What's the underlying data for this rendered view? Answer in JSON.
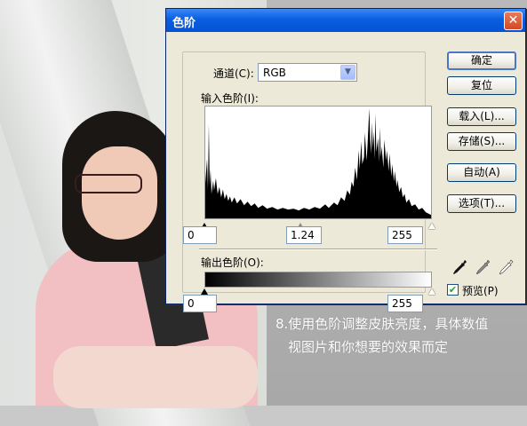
{
  "dialog": {
    "title": "色阶",
    "close_label": "✕",
    "channel": {
      "label": "通道(C):",
      "value": "RGB"
    },
    "input_levels": {
      "label": "输入色阶(I):",
      "black": "0",
      "gamma": "1.24",
      "white": "255"
    },
    "output_levels": {
      "label": "输出色阶(O):",
      "black": "0",
      "white": "255"
    },
    "buttons": {
      "ok": "确定",
      "reset": "复位",
      "load": "载入(L)...",
      "save": "存储(S)...",
      "auto": "自动(A)",
      "options": "选项(T)..."
    },
    "eyedroppers": [
      "black-point-eyedropper-icon",
      "gray-point-eyedropper-icon",
      "white-point-eyedropper-icon"
    ],
    "preview": {
      "label": "预览(P)",
      "checked": true
    }
  },
  "caption": {
    "line1": "8.使用色阶调整皮肤亮度，具体数值",
    "line2": "视图片和你想要的效果而定"
  },
  "colors": {
    "title_bar": "#0453d4",
    "dialog_bg": "#ece9d8",
    "close_button": "#d24a24",
    "check_mark": "#21a121"
  }
}
